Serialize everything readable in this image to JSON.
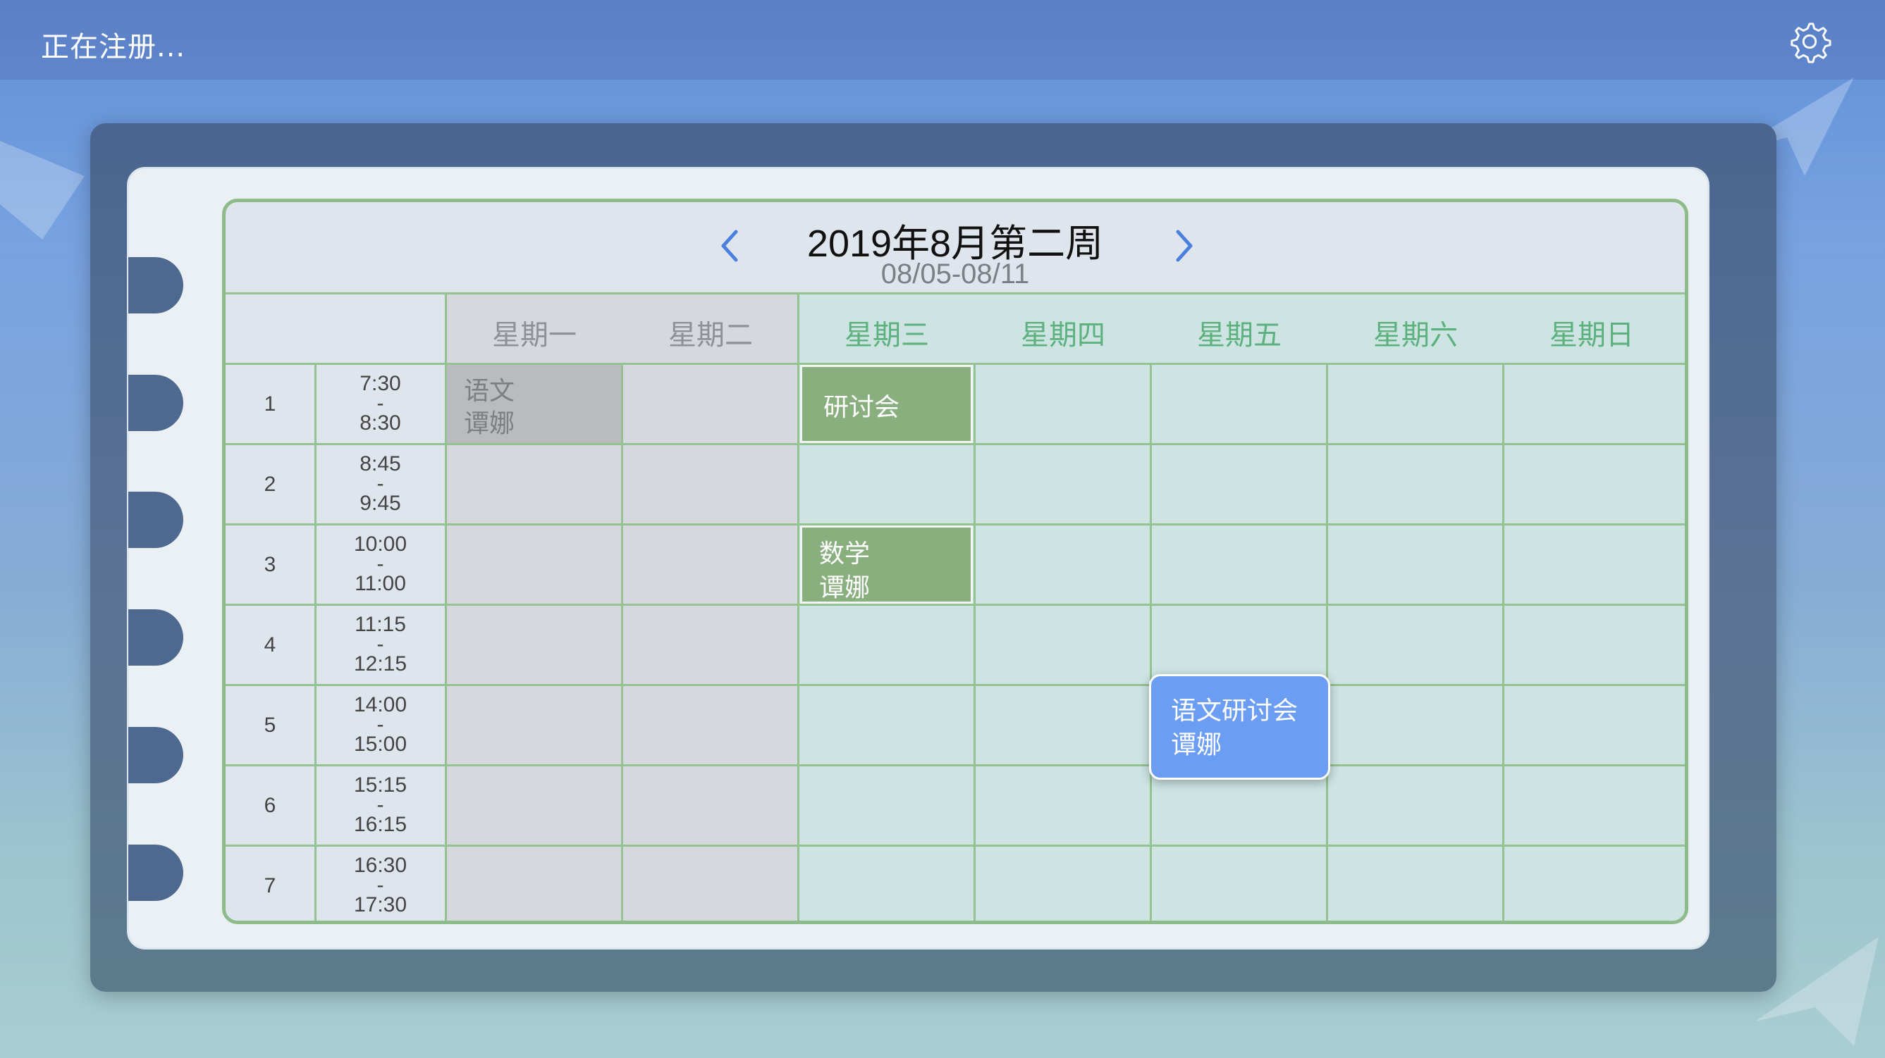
{
  "status": "正在注册...",
  "header": {
    "title": "2019年8月第二周",
    "range": "08/05-08/11"
  },
  "days": [
    "星期一",
    "星期二",
    "星期三",
    "星期四",
    "星期五",
    "星期六",
    "星期日"
  ],
  "periods": [
    {
      "num": "1",
      "start": "7:30",
      "sep": "-",
      "end": "8:30"
    },
    {
      "num": "2",
      "start": "8:45",
      "sep": "-",
      "end": "9:45"
    },
    {
      "num": "3",
      "start": "10:00",
      "sep": "-",
      "end": "11:00"
    },
    {
      "num": "4",
      "start": "11:15",
      "sep": "-",
      "end": "12:15"
    },
    {
      "num": "5",
      "start": "14:00",
      "sep": "-",
      "end": "15:00"
    },
    {
      "num": "6",
      "start": "15:15",
      "sep": "-",
      "end": "16:15"
    },
    {
      "num": "7",
      "start": "16:30",
      "sep": "-",
      "end": "17:30"
    }
  ],
  "events": {
    "mon_p1": {
      "line1": "语文",
      "line2": "谭娜"
    },
    "wed_p1": {
      "line1": "研讨会"
    },
    "wed_p3": {
      "line1": "数学",
      "line2": "谭娜"
    },
    "fri_p5": {
      "line1": "语文研讨会",
      "line2": "谭娜"
    }
  },
  "colors": {
    "past_bg": "#d5d8dd",
    "current_bg": "#cde4e3",
    "grid_line": "#95c292",
    "header_green": "#5cb17f",
    "event_green": "#8aaf7e",
    "event_past": "#b9bbbe",
    "event_blue": "#6b9ef2"
  },
  "icons": {
    "settings": "gear-icon",
    "prev": "chevron-left-icon",
    "next": "chevron-right-icon"
  }
}
